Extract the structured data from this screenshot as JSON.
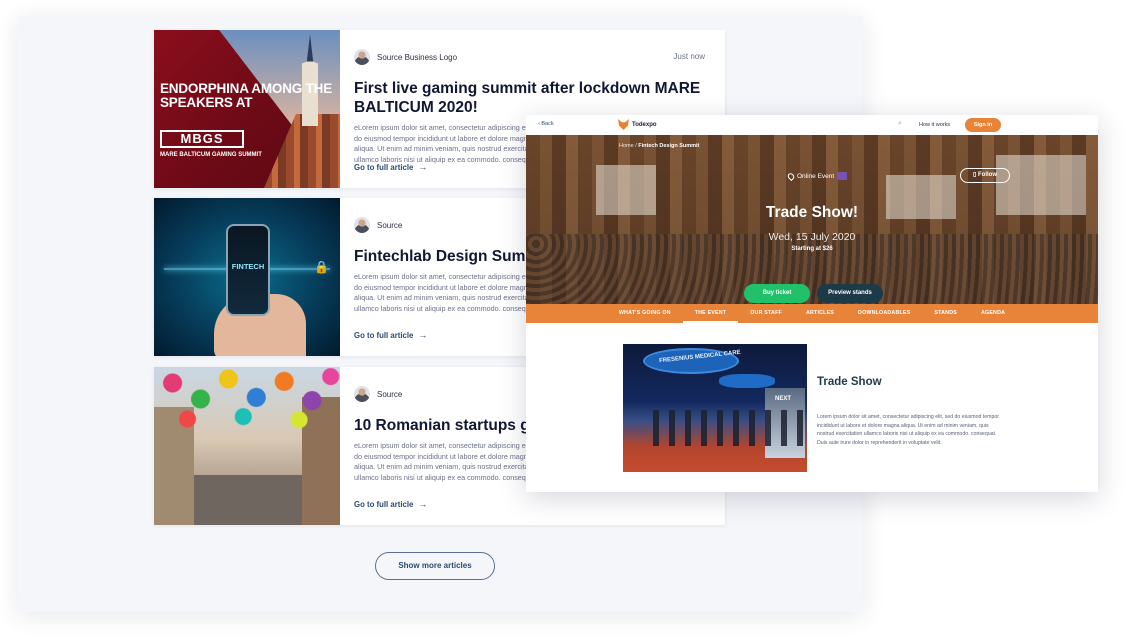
{
  "feed": {
    "articles": [
      {
        "source": "Source Business Logo",
        "time": "Just now",
        "title": "First live gaming summit after lockdown MARE BALTICUM 2020!",
        "excerpt": "eLorem ipsum dolor sit amet, consectetur adipiscing elit, sed do eiusmod tempor incididunt ut labore et dolore magna aliqua. Ut enim ad minim veniam, quis nostrud exercitation ullamco laboris nisi ut aliquip ex ea commodo. consequat. Duis aute",
        "link": "Go to full article",
        "thumb": {
          "headline": "ENDORPHINA AMONG THE SPEAKERS AT",
          "logo": "MBGS",
          "sub": "MARE BALTICUM GAMING SUMMIT"
        }
      },
      {
        "source": "Source",
        "time": "",
        "title": "Fintechlab Design Summit Success Stories",
        "excerpt": "eLorem ipsum dolor sit amet, consectetur adipiscing elit, sed do eiusmod tempor incididunt ut labore et dolore magna aliqua. Ut enim ad minim veniam, quis nostrud exercitation ullamco laboris nisi ut aliquip ex ea commodo. consequat. Duis aute",
        "link": "Go to full article",
        "thumb": {
          "label": "FINTECH"
        }
      },
      {
        "source": "Source",
        "time": "",
        "title": "10 Romanian startups getting attention in 2020",
        "excerpt": "eLorem ipsum dolor sit amet, consectetur adipiscing elit, sed do eiusmod tempor incididunt ut labore et dolore magna aliqua. Ut enim ad minim veniam, quis nostrud exercitation ullamco laboris nisi ut aliquip ex ea commodo. consequat. Duis aute",
        "link": "Go to full article"
      }
    ],
    "show_more": "Show more articles"
  },
  "event": {
    "nav": {
      "back": "‹ Back",
      "brand": "Todexpo",
      "how_it_works": "How it works",
      "sign_in": "Sign in",
      "search_icon": "search-icon"
    },
    "breadcrumb": {
      "home": "Home",
      "separator": "/",
      "current": "Fintech Design Summit"
    },
    "hero": {
      "location": "Online Event",
      "follow": "Follow",
      "title": "Trade Show!",
      "date": "Wed, 15 July 2020",
      "price": "Starting at $26",
      "buy": "Buy ticket",
      "preview": "Preview stands"
    },
    "tabs": [
      "WHAT'S GOING ON",
      "THE EVENT",
      "OUR STAFF",
      "ARTICLES",
      "DOWNLOADABLES",
      "STANDS",
      "AGENDA"
    ],
    "active_tab": "THE EVENT",
    "section": {
      "image_caption": "FRESENIUS MEDICAL CARE",
      "image_sign": "NEXT",
      "title": "Trade Show",
      "text": "Lorem ipsum dolor sit amet, consectetur adipiscing elit, sed do eiusmod tempor incididunt ut labore et dolore magna aliqua. Ut enim ad minim veniam, quis nostrud exercitation ullamco laboris nisi ut aliquip ex ea commodo. consequat. Duis aute irure dolor in reprehenderit in voluptate velit."
    }
  },
  "colors": {
    "accent_orange": "#e8843a",
    "buy_green": "#21c06a",
    "preview_dark": "#1c3a47",
    "link_blue": "#2c4a70"
  }
}
